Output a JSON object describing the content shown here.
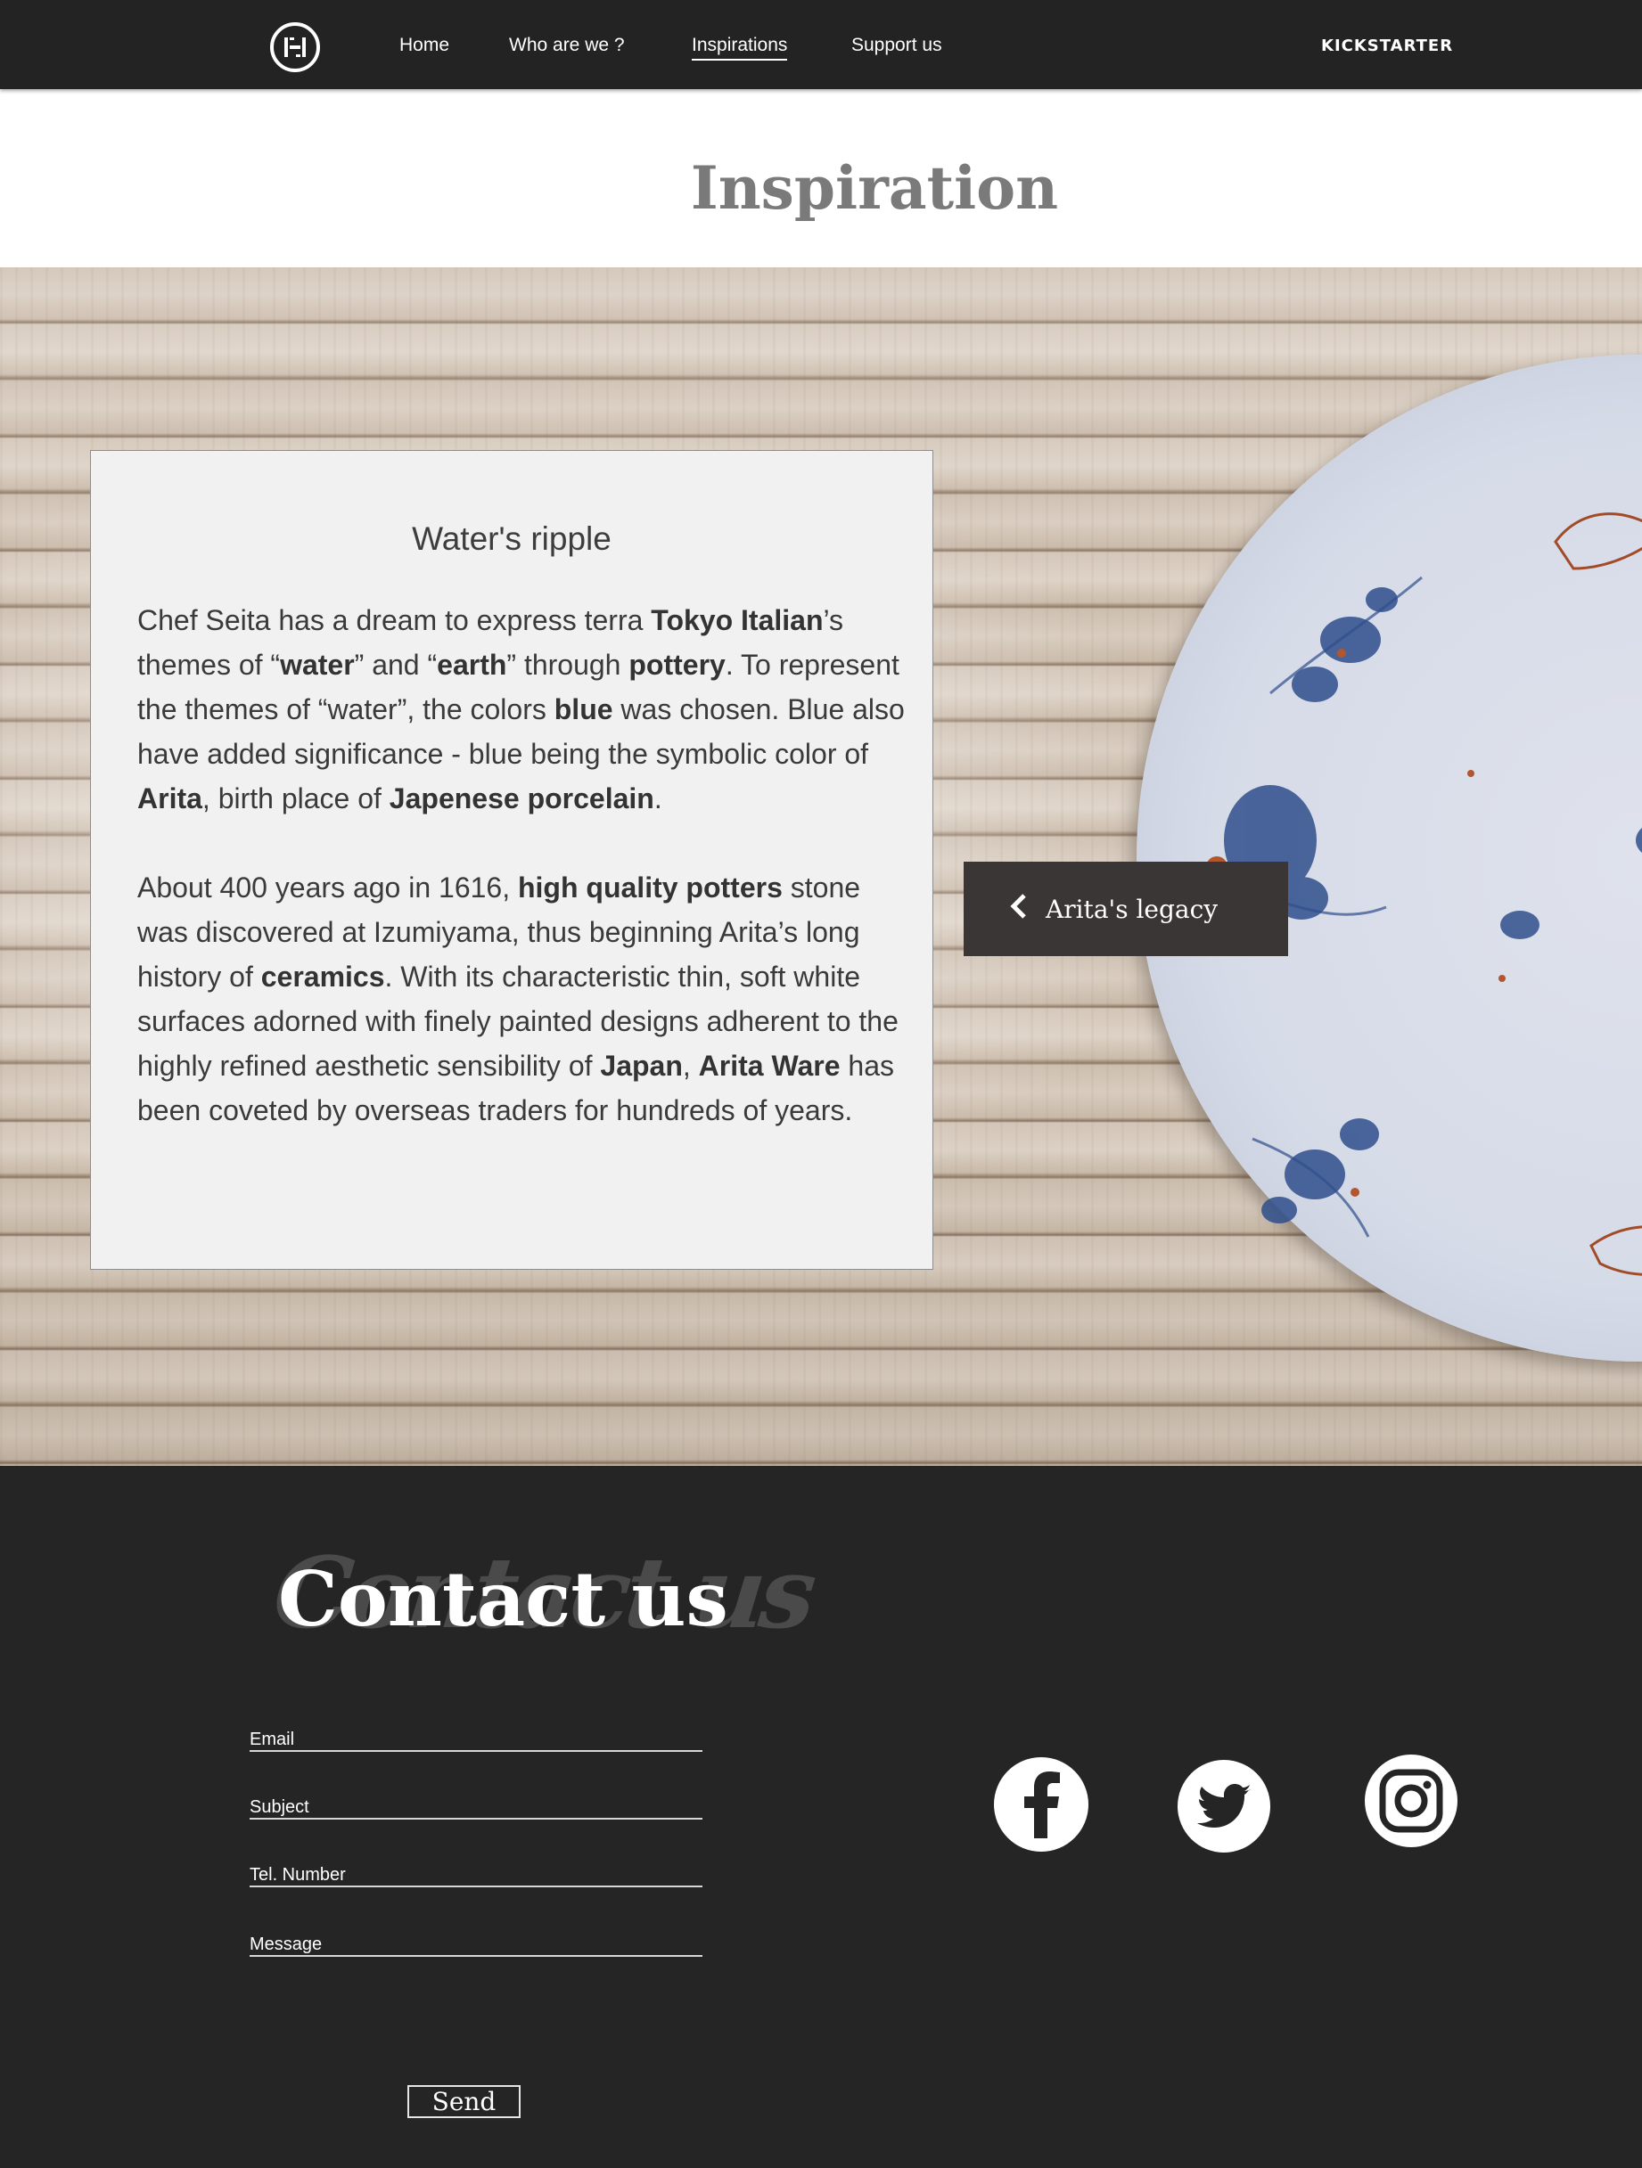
{
  "nav": {
    "links": [
      "Home",
      "Who are we ?",
      "Inspirations",
      "Support us"
    ],
    "active": "Inspirations",
    "kickstarter": "KICKSTARTER"
  },
  "page": {
    "title": "Inspiration"
  },
  "card": {
    "heading": "Water's ripple",
    "p1": [
      {
        "t": "Chef Seita has a dream to express terra "
      },
      {
        "t": "Tokyo Italian",
        "b": true
      },
      {
        "t": "’s themes of “"
      },
      {
        "t": "water",
        "b": true
      },
      {
        "t": "” and “"
      },
      {
        "t": "earth",
        "b": true
      },
      {
        "t": "” through "
      },
      {
        "t": "pottery",
        "b": true
      },
      {
        "t": ". To represent the themes of “water”, the colors "
      },
      {
        "t": "blue",
        "b": true
      },
      {
        "t": " was chosen. Blue also have added significance - blue being the symbolic color of "
      },
      {
        "t": "Arita",
        "b": true
      },
      {
        "t": ", birth place of "
      },
      {
        "t": "Japenese porcelain",
        "b": true
      },
      {
        "t": "."
      }
    ],
    "p2": [
      {
        "t": "About 400 years ago in 1616, "
      },
      {
        "t": "high quality potters",
        "b": true
      },
      {
        "t": " stone was discovered at Izumiyama, thus beginning Arita’s long history of "
      },
      {
        "t": "ceramics",
        "b": true
      },
      {
        "t": ". With its characteristic thin, soft white surfaces adorned with finely painted designs adherent to the highly refined aesthetic sensibility of "
      },
      {
        "t": "Japan",
        "b": true
      },
      {
        "t": ", "
      },
      {
        "t": "Arita Ware",
        "b": true
      },
      {
        "t": " has been coveted by overseas traders for hundreds of years."
      }
    ]
  },
  "legacy_button": "Arita's legacy",
  "contact": {
    "title": "Contact us",
    "background_script": "Contact us",
    "fields": [
      "Email",
      "Subject",
      "Tel. Number",
      "Message"
    ],
    "send": "Send"
  },
  "social": [
    "facebook-icon",
    "twitter-icon",
    "instagram-icon"
  ]
}
